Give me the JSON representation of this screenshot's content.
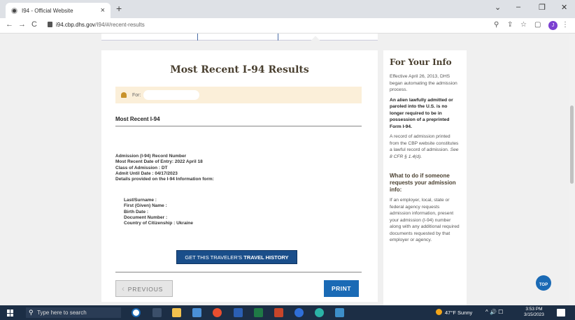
{
  "browser": {
    "tab_title": "I94 - Official Website",
    "tab_close": "×",
    "new_tab": "+",
    "url_host": "i94.cbp.dhs.gov",
    "url_path": "/I94/#/recent-results",
    "profile_initial": "J",
    "window_controls": {
      "chevron": "⌄",
      "minimize": "–",
      "restore": "❐",
      "close": "✕"
    },
    "nav": {
      "back": "←",
      "forward": "→",
      "reload": "C"
    },
    "addr_icons": {
      "zoom": "⚲",
      "share": "⇪",
      "star": "☆",
      "sidebar": "▢",
      "menu": "⋮"
    }
  },
  "results": {
    "title": "Most Recent I-94 Results",
    "for_label": "For:",
    "section_heading": "Most Recent I-94",
    "details": [
      "Admission (I-94) Record Number",
      "Most Recent Date of Entry: 2022 April 18",
      "Class of Admission : DT",
      "Admit Until Date : 04/17/2023",
      "Details provided on the I-94 Information form:"
    ],
    "traveler": [
      "Last/Surname :",
      "First (Given) Name :",
      "Birth Date :",
      "Document Number :",
      "Country of Citizenship : Ukraine"
    ],
    "history_button_prefix": "GET THIS TRAVELER'S ",
    "history_button_bold": "TRAVEL HISTORY",
    "prev_icon": "‹",
    "prev_label": "PREVIOUS",
    "print_label": "PRINT"
  },
  "sidebar": {
    "title": "For Your Info",
    "p1": "Effective April 26, 2013, DHS began automating the admission process.",
    "p2": "An alien lawfully admitted or paroled into the U.S. is no longer required to be in possession of a preprinted Form I-94.",
    "p3_text": "A record of admission printed from the CBP website constitutes a lawful record of admission. ",
    "p3_cite": "See 8 CFR § 1.4(d).",
    "sub_heading": "What to do if someone requests your admission info:",
    "p4": "If an employer, local, state or federal agency requests admission information, present your admission (I-94) number along with any additional required documents requested by that employer or agency."
  },
  "top_button": "TOP",
  "taskbar": {
    "search_icon": "⚲",
    "search_placeholder": "Type here to search",
    "temperature": "47°F",
    "weather": "Sunny",
    "tray_icons": "^ 🔊 ☐",
    "time": "3:53 PM",
    "date": "3/15/2023"
  },
  "colors": {
    "accent_blue": "#1a4e8a",
    "print_blue": "#1a6ab5",
    "for_box_bg": "#fbefd9",
    "heading_brown": "#4a4030"
  }
}
